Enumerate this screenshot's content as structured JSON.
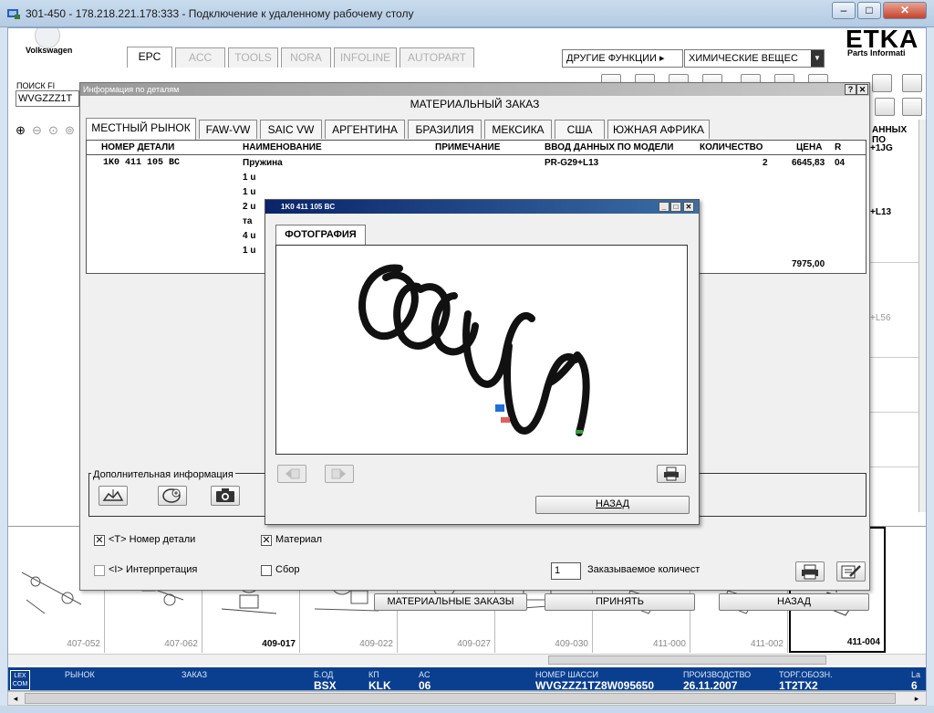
{
  "window": {
    "title": "301-450 - 178.218.221.178:333 - Подключение к удаленному рабочему столу"
  },
  "app": {
    "brand": "Volkswagen",
    "logo_text": "ETKA",
    "logo_sub": "Parts Informati",
    "tabs": [
      "EPC",
      "ACC",
      "TOOLS",
      "NORA",
      "INFOLINE",
      "AUTOPART"
    ],
    "other_functions": "ДРУГИЕ ФУНКЦИИ ▸",
    "chemicals": "ХИМИЧЕСКИЕ ВЕЩЕС",
    "search_label": "ПОИСК FI",
    "search_value": "WVGZZZ1T",
    "bg_right": {
      "col": "АННЫХ ПО",
      "r1": "+1JG",
      "r2": "+L13",
      "r3": "+L56"
    }
  },
  "info_dialog": {
    "title": "Информация по деталям",
    "header": "МАТЕРИАЛЬНЫЙ ЗАКАЗ",
    "tabs": [
      "МЕСТНЫЙ РЫНОК",
      "FAW-VW",
      "SAIC VW",
      "АРГЕНТИНА",
      "БРАЗИЛИЯ",
      "МЕКСИКА",
      "США",
      "ЮЖНАЯ АФРИКА"
    ],
    "columns": [
      "НОМЕР ДЕТАЛИ",
      "НАИМЕНОВАНИЕ",
      "ПРИМЕЧАНИЕ",
      "ВВОД ДАННЫХ ПО МОДЕЛИ",
      "КОЛИЧЕСТВО",
      "ЦЕНА",
      "R"
    ],
    "row": {
      "part": "1K0 411 105 BC",
      "name": "Пружина",
      "model": "PR-G29+L13",
      "qty": "2",
      "price": "6645,83",
      "r": "04"
    },
    "name_lines": [
      "1 u",
      "1 u",
      "2 u",
      "та",
      "4 u",
      "1 u"
    ],
    "total": "7975,00",
    "additional_info": "Дополнительная информация",
    "chk_part": "<T> Номер детали",
    "chk_material": "Материал",
    "chk_interp": "<I> Интерпретация",
    "chk_assembly": "Сбор",
    "qty_value": "1",
    "qty_label": "Заказываемое количест",
    "btn_orders": "МАТЕРИАЛЬНЫЕ ЗАКАЗЫ",
    "btn_accept": "ПРИНЯТЬ",
    "btn_back": "НАЗАД"
  },
  "photo_dialog": {
    "title": "1K0 411 105 BC",
    "tab": "ФОТОГРАФИЯ",
    "back": "НАЗАД"
  },
  "thumbnails": [
    "407-052",
    "407-062",
    "409-017",
    "409-022",
    "409-027",
    "409-030",
    "411-000",
    "411-002",
    "411-004"
  ],
  "status": {
    "market": "РЫНОК",
    "order": "ЗАКАЗ",
    "bod_label": "Б.ОД",
    "bod": "BSX",
    "kp_label": "КП",
    "kp": "KLK",
    "ac_label": "AC",
    "ac": "06",
    "chassis_label": "НОМЕР ШАССИ",
    "chassis": "WVGZZZ1TZ8W095650",
    "prod_label": "ПРОИЗВОДСТВО",
    "prod": "26.11.2007",
    "trade_label": "ТОРГ.ОБОЗН.",
    "trade": "1T2TX2",
    "extra_label": "Lа",
    "extra": "6"
  }
}
